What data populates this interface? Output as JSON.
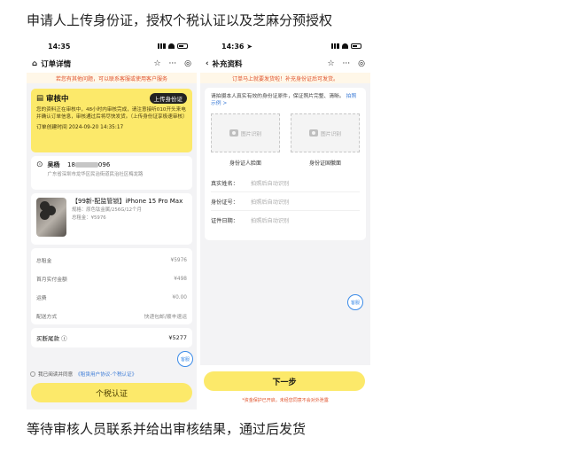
{
  "heading": "申请人上传身份证，授权个税认证以及芝麻分预授权",
  "footer_caption": "等待审核人员联系并给出审核结果，通过后发货",
  "left": {
    "time": "14:35",
    "nav_title": "订单详情",
    "nav_actions": [
      "☆",
      "···",
      "◎"
    ],
    "notice": "若您有其他问题，可以联系客服或使用客户服务",
    "status_title": "审核中",
    "status_button": "上传身份证",
    "status_text": "您的资料正在审核中，48小时内审核完成，请注意接听010开头来电并确认订单信息，审核通过后将尽快发货。（上传身份证享极速审核）",
    "order_time": "订单创建时间 2024-09-20 14:35:17",
    "address_name": "吴杨",
    "phone_suffix": "096",
    "address_line": "广东省深圳市龙华区民治街道民治社区梅龙路",
    "product_title": "【99新-配监管锁】iPhone 15 Pro Max",
    "product_spec": "规格：原色钛金属/256G/12个月",
    "product_price": "总租金：¥5976",
    "fees": [
      {
        "label": "总租金",
        "value": "¥5976"
      },
      {
        "label": "首月实付金额",
        "value": "¥498"
      },
      {
        "label": "运费",
        "value": "¥0.00"
      },
      {
        "label": "配送方式",
        "value": "快递包邮/顺丰速运"
      }
    ],
    "pay_label": "买断尾款 ⓘ",
    "pay_value": "¥5277",
    "agree_text": "我已阅读并同意",
    "agree_link": "《租赁用户协议-个税认证》",
    "main_button": "个税认证",
    "float_label": "客服"
  },
  "right": {
    "time": "14:36",
    "nav_title": "补充资料",
    "nav_actions": [
      "☆",
      "···",
      "◎"
    ],
    "notice": "订单马上就要发货啦！补充身份证后可发货。",
    "tip": "请拍摄本人真实有效的身份证原件，保证照片完整、清晰。",
    "tip_link": "拍照示例 >",
    "photo_hint": "图片识别",
    "front_caption": "身份证人脸面",
    "back_caption": "身份证国徽面",
    "fields": [
      {
        "label": "真实姓名：",
        "value": "拍照后自动识别"
      },
      {
        "label": "身份证号：",
        "value": "拍照后自动识别"
      },
      {
        "label": "证件日期：",
        "value": "拍照后自动识别"
      }
    ],
    "next_button": "下一步",
    "safe_note": "*资金保护已开启，未经您同意不会对外泄露",
    "float_label": "客服"
  },
  "colors": {
    "accent_yellow": "#fce96a",
    "notice_red": "#e0532c",
    "link_blue": "#3b7bd6"
  }
}
